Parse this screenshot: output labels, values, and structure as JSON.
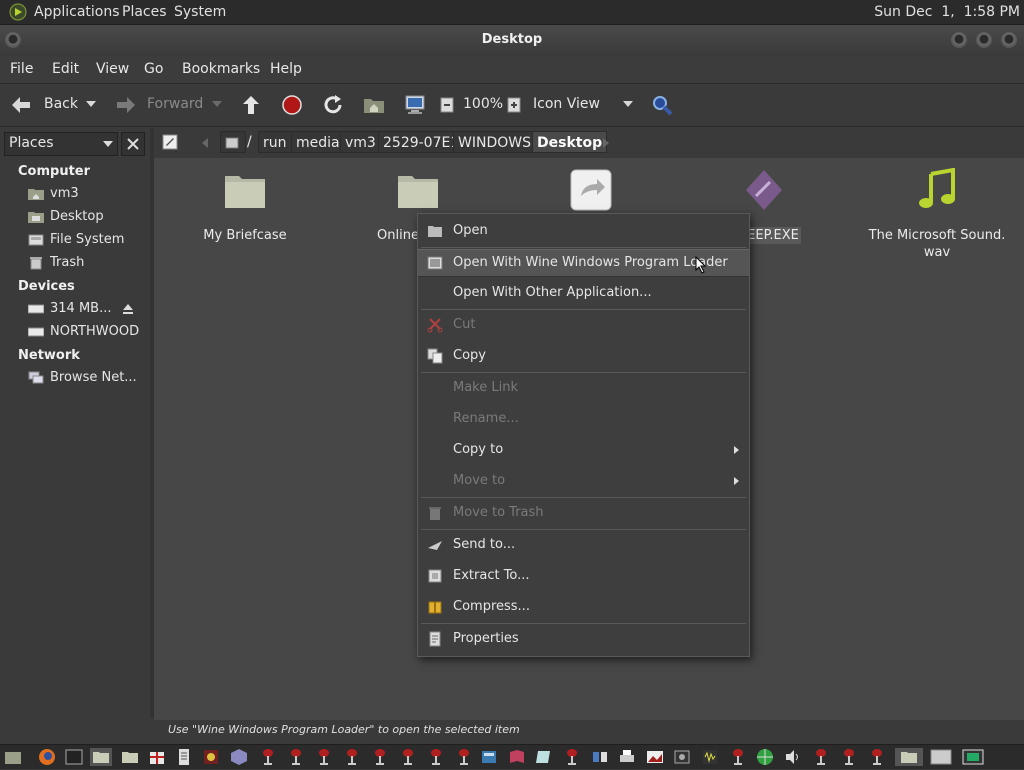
{
  "top_panel": {
    "applications": "Applications",
    "places": "Places",
    "system": "System",
    "clock": "Sun Dec  1,  1:58 PM"
  },
  "window": {
    "title": "Desktop"
  },
  "menubar": [
    "File",
    "Edit",
    "View",
    "Go",
    "Bookmarks",
    "Help"
  ],
  "toolbar": {
    "back": "Back",
    "forward": "Forward",
    "zoom": "100%",
    "view_mode": "Icon View"
  },
  "sidebar": {
    "selector": "Places",
    "computer_header": "Computer",
    "computer_items": [
      "vm3",
      "Desktop",
      "File System",
      "Trash"
    ],
    "devices_header": "Devices",
    "device_items": [
      "314 MB...",
      "NORTHWOOD"
    ],
    "network_header": "Network",
    "network_items": [
      "Browse Net..."
    ]
  },
  "pathbar": [
    "/",
    "run",
    "media",
    "vm3",
    "2529-07E1",
    "WINDOWS",
    "Desktop"
  ],
  "files": [
    {
      "name": "My Briefcase",
      "icon": "folder-icon"
    },
    {
      "name": "Online",
      "icon": "folder-icon"
    },
    {
      "name": "",
      "icon": "shortcut-icon"
    },
    {
      "name": "EEP.EXE",
      "icon": "wine-exe-icon"
    },
    {
      "name": "The Microsoft Sound.\nwav",
      "icon": "music-note-icon"
    }
  ],
  "context_menu": {
    "open": "Open",
    "open_with_wine": "Open With Wine Windows Program Loader",
    "open_with_other": "Open With Other Application...",
    "cut": "Cut",
    "copy": "Copy",
    "make_link": "Make Link",
    "rename": "Rename...",
    "copy_to": "Copy to",
    "move_to": "Move to",
    "move_to_trash": "Move to Trash",
    "send_to": "Send to...",
    "extract_to": "Extract To...",
    "compress": "Compress...",
    "properties": "Properties"
  },
  "statusbar": {
    "text": "Use \"Wine Windows Program Loader\" to open the selected item"
  },
  "colors": {
    "panel": "#2b2b2b",
    "window_bg": "#3a3a3a",
    "view_bg": "#474747",
    "menu_bg": "#3e3e3e",
    "highlight": "#555555",
    "accent_green": "#b8d430"
  }
}
